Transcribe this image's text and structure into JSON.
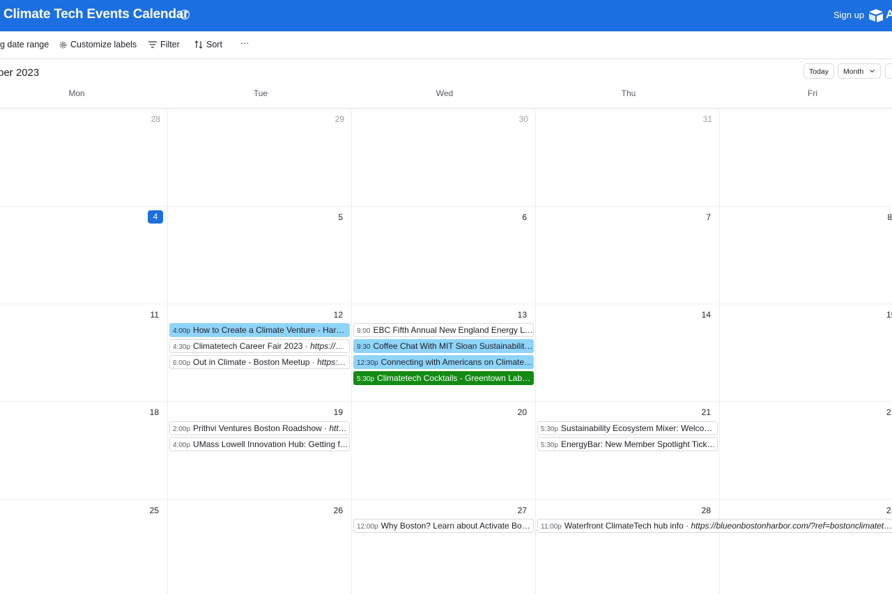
{
  "app": {
    "title": "Climate Tech Events Calendar",
    "signup": "Sign up",
    "logo_text": "A",
    "brand_color": "#1b6fe0"
  },
  "toolbar": {
    "date_range": "g date range",
    "customize_labels": "Customize labels",
    "filter": "Filter",
    "sort": "Sort",
    "more": "···"
  },
  "calendar": {
    "month_label": "ber 2023",
    "today_button": "Today",
    "view_select": "Month",
    "weekdays": [
      "Mon",
      "Tue",
      "Wed",
      "Thu",
      "Fri"
    ],
    "weeks": [
      [
        "28",
        "29",
        "30",
        "31",
        ""
      ],
      [
        "4",
        "5",
        "6",
        "7",
        "8"
      ],
      [
        "11",
        "12",
        "13",
        "14",
        "15"
      ],
      [
        "18",
        "19",
        "20",
        "21",
        "2"
      ],
      [
        "25",
        "26",
        "27",
        "28",
        "2"
      ]
    ],
    "today": "4",
    "events": {
      "e1": {
        "time": "4:00p",
        "name": "How to Create a Climate Venture - Har…"
      },
      "e2": {
        "time": "4:30p",
        "name": "Climatetech Career Fair 2023 ",
        "url": "· https://…"
      },
      "e3": {
        "time": "6:00p",
        "name": "Out in Climate - Boston Meetup ",
        "url": "· https:…"
      },
      "e4": {
        "time": "9:00",
        "name": "EBC Fifth Annual New England Energy L…"
      },
      "e5": {
        "time": "9:30",
        "name": "Coffee Chat With MIT Sloan Sustainabilit…"
      },
      "e6": {
        "time": "12:30p",
        "name": "Connecting with Americans on Climate…"
      },
      "e7": {
        "time": "5:30p",
        "name": "Climatetech Cocktails - Greentown Lab…"
      },
      "e8": {
        "time": "2:00p",
        "name": "Prithvi Ventures Boston Roadshow ",
        "url": "· htt…"
      },
      "e9": {
        "time": "4:00p",
        "name": "UMass Lowell Innovation Hub: Getting f…"
      },
      "e10": {
        "time": "5:30p",
        "name": "Sustainability Ecosystem Mixer: Welco…"
      },
      "e11": {
        "time": "5:30p",
        "name": "EnergyBar: New Member Spotlight Tick…"
      },
      "e12": {
        "time": "12:00p",
        "name": "Why Boston? Learn about Activate Bo…"
      },
      "e13": {
        "time": "11:00p",
        "name": "Waterfront ClimateTech hub info ",
        "url": "· https://blueonbostonharbor.com/?ref=bostonclimatet…"
      }
    },
    "colors": {
      "blue_event": "#8fd4fb",
      "green_event": "#138a13"
    }
  }
}
